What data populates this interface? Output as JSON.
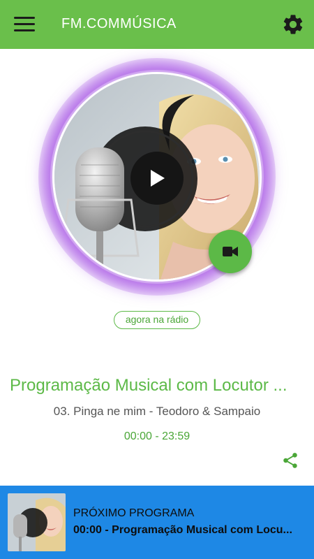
{
  "appbar": {
    "title": "FM.COMMÚSICA",
    "menu_icon": "hamburger-menu-icon",
    "settings_icon": "gear-icon",
    "color": "#6abf4b"
  },
  "player": {
    "artwork": "woman-singing-into-studio-microphone",
    "play_icon": "play-icon",
    "video_icon": "video-camera-icon",
    "live_badge": "agora na rádio",
    "program_title": "Programação Musical com Locutor ...",
    "track": "03. Pinga ne mim - Teodoro & Sampaio",
    "time": "00:00 - 23:59",
    "share_icon": "share-icon",
    "accent": "#5cb947",
    "glow_color": "#b068e6"
  },
  "next_program": {
    "label": "PRÓXIMO PROGRAMA",
    "title": "00:00 - Programação Musical com Locu...",
    "color": "#1e88e5"
  }
}
